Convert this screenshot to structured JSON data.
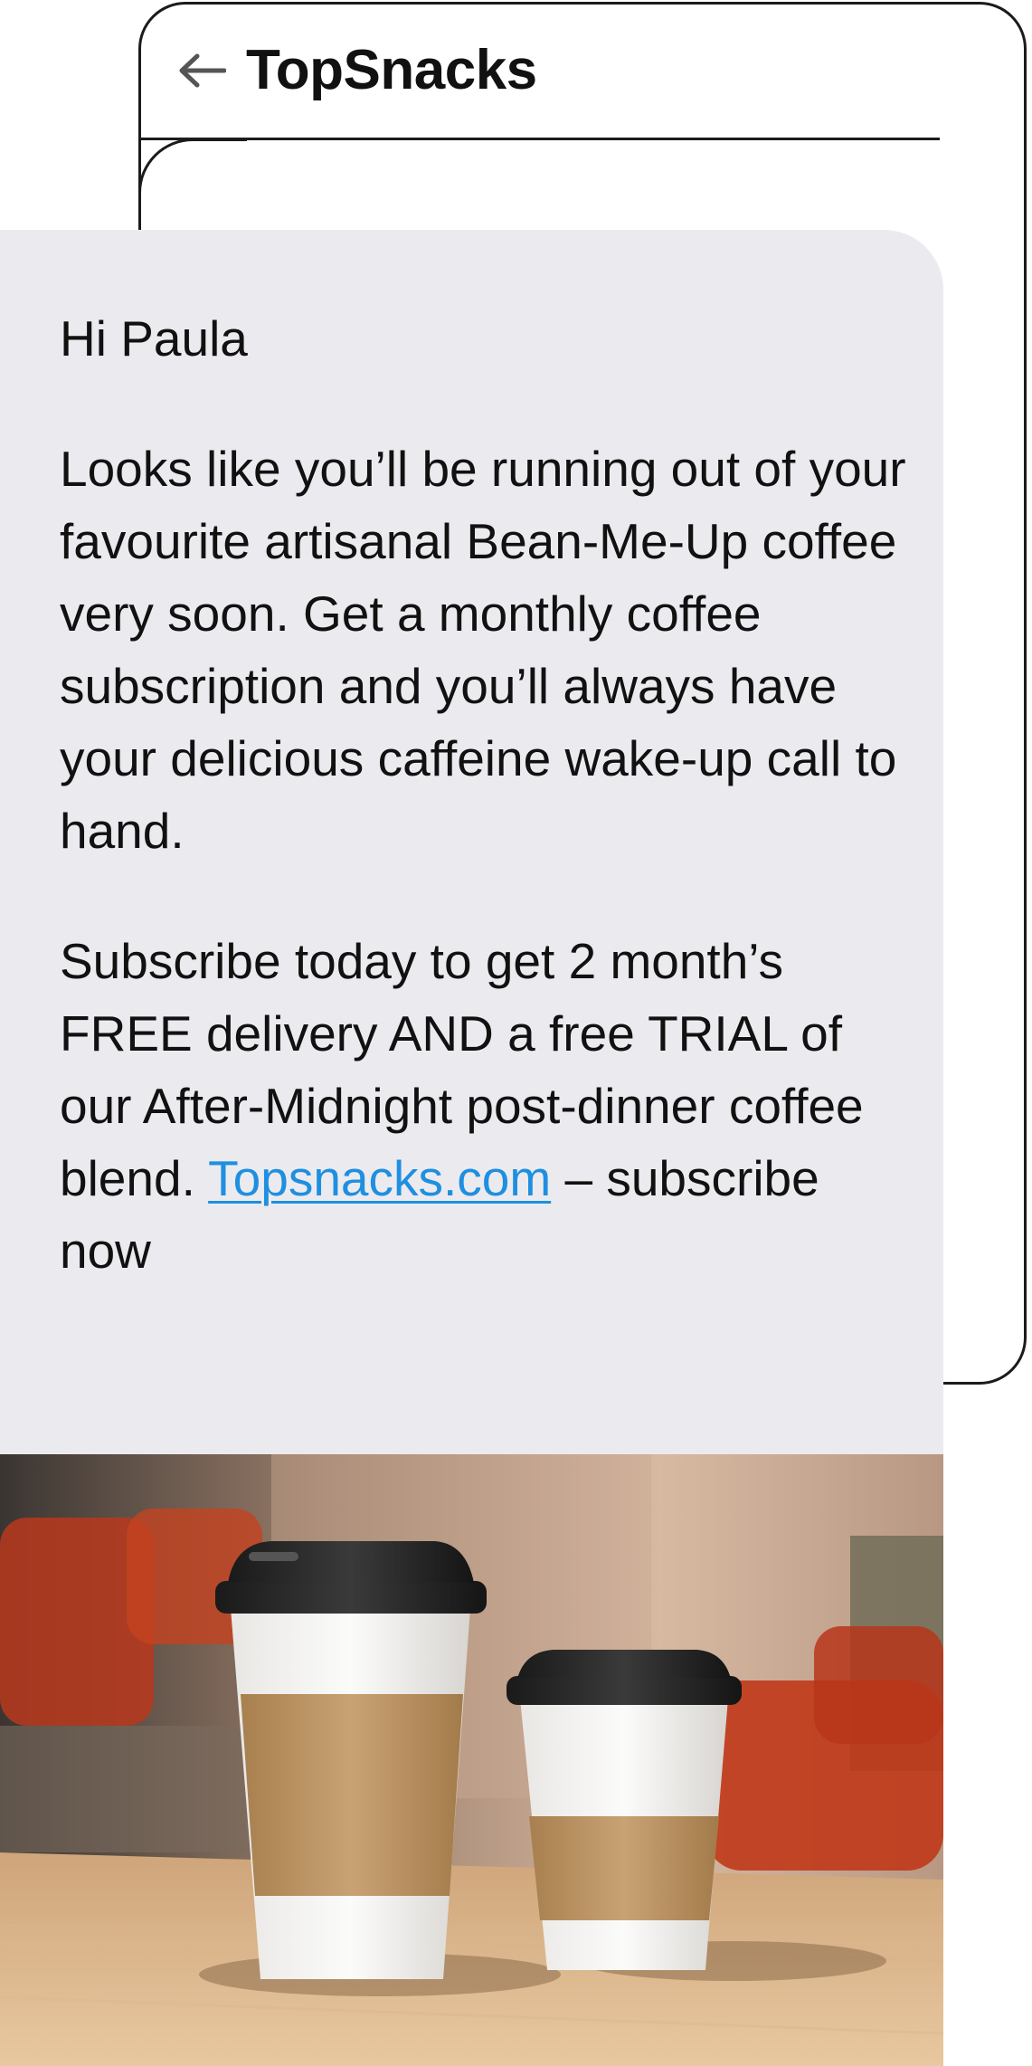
{
  "header": {
    "title": "TopSnacks"
  },
  "message": {
    "greeting": "Hi Paula",
    "paragraph1": "Looks like you’ll be running out of your favourite artisanal Bean-Me-Up coffee very soon. Get a monthly coffee subscription and you’ll always have your delicious caffeine wake-up call to hand.",
    "paragraph2_before_link": "Subscribe today to get 2 month’s FREE delivery AND a free TRIAL of our After-Midnight post-dinner coffee blend. ",
    "link_text": "Topsnacks.com",
    "paragraph2_after_link": " – subscribe now"
  },
  "colors": {
    "bubble_bg": "#ebebef",
    "link": "#1f8fe0",
    "outline": "#1b1b1b"
  },
  "icons": {
    "back": "back-arrow-icon"
  }
}
